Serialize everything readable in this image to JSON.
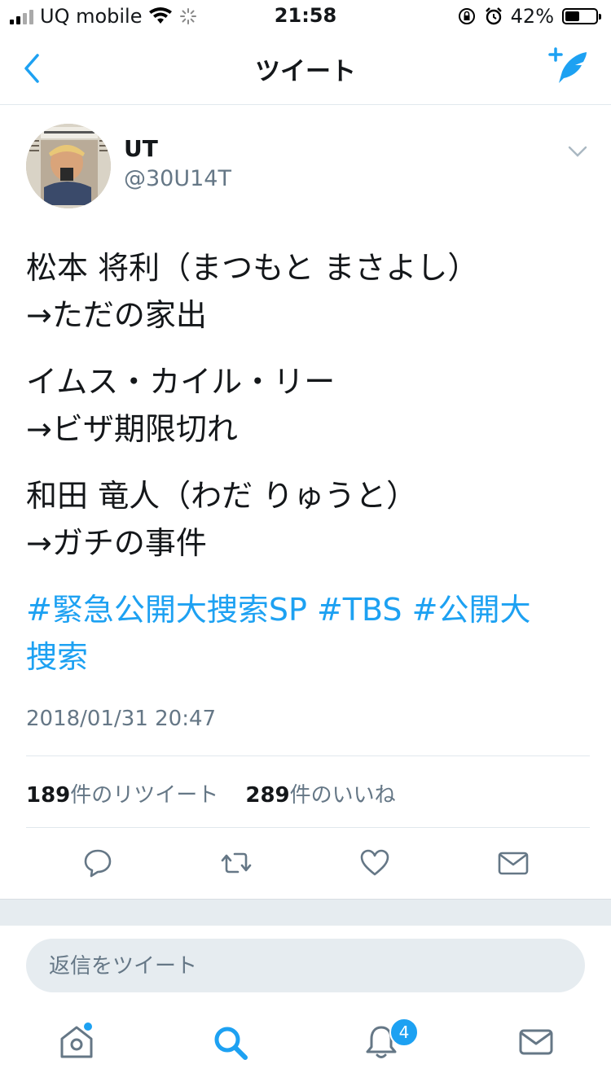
{
  "status_bar": {
    "carrier": "UQ mobile",
    "time": "21:58",
    "battery": "42%",
    "battery_level": 0.42
  },
  "nav": {
    "title": "ツイート",
    "back_icon": "chevron-left-icon",
    "compose_icon": "compose-tweet-icon"
  },
  "author": {
    "name": "UT",
    "handle": "@30U14T"
  },
  "tweet": {
    "paragraphs": [
      [
        "松本 将利（まつもと まさよし）",
        "→ただの家出"
      ],
      [
        "イムス・カイル・リー",
        "→ビザ期限切れ"
      ],
      [
        "和田 竜人（わだ りゅうと）",
        "→ガチの事件"
      ]
    ],
    "hashtags_line1": "#緊急公開大捜索SP #TBS #公開大",
    "hashtags_line2": "捜索",
    "timestamp": "2018/01/31 20:47"
  },
  "stats": {
    "retweet_count": "189",
    "retweet_label": "件のリツイート",
    "like_count": "289",
    "like_label": "件のいいね"
  },
  "reply": {
    "placeholder": "返信をツイート"
  },
  "tabbar": {
    "notification_badge": "4"
  },
  "colors": {
    "accent": "#1da1f2",
    "text": "#14171a",
    "muted": "#657786",
    "divider": "#e1e8ed"
  }
}
